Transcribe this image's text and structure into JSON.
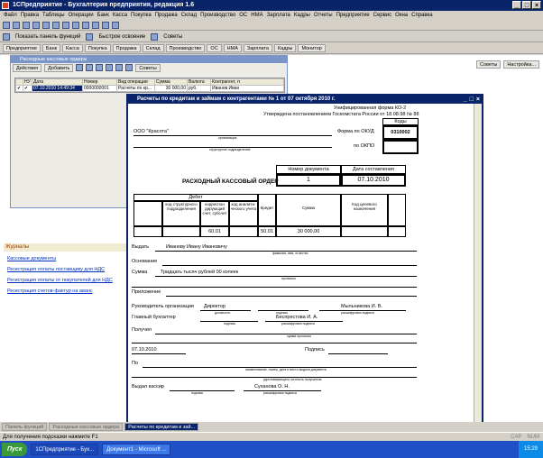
{
  "app": {
    "title": "1СПредприятие - Бухгалтерия предприятия, редакция 1.6"
  },
  "menu": [
    "Файл",
    "Правка",
    "Таблицы",
    "Операции",
    "Банк",
    "Касса",
    "Покупка",
    "Продажа",
    "Склад",
    "Производство",
    "ОС",
    "НМА",
    "Зарплата",
    "Кадры",
    "Отчеты",
    "Предприятие",
    "Сервис",
    "Окна",
    "Справка"
  ],
  "toolbar2": {
    "show_panel": "Показать панель функций",
    "quick_start": "Быстрое освоение",
    "tips": "Советы"
  },
  "toolbar3": [
    "Предприятие",
    "Банк",
    "Касса",
    "Покупка",
    "Продажа",
    "Склад",
    "Производство",
    "ОС",
    "НМА",
    "Зарплата",
    "Кадры",
    "Монитор"
  ],
  "workspace": {
    "tips_btn": "Советы",
    "settings_btn": "Настройка..."
  },
  "journal": {
    "title": "Журналы",
    "links": [
      "Кассовые документы",
      "Регистрация оплаты поставщику для НДС",
      "Регистрация оплаты от покупателей для НДС",
      "Регистрация счетов-фактур на аванс"
    ]
  },
  "subwin": {
    "title": "Расходные кассовые ордера",
    "actions": "Действия",
    "add": "Добавить",
    "tips": "Советы",
    "columns": [
      "",
      "НУ",
      "Дата",
      "Номер",
      "Вид операции",
      "Сумма",
      "Валюта",
      "Контрагент, п"
    ],
    "rows": [
      [
        "✔",
        "✔",
        "07.10.2010 14:49:34",
        "0000000001",
        "Расчеты по кр...",
        "30 000,00",
        "руб.",
        "Иванов Иван"
      ]
    ]
  },
  "doc": {
    "title": "Расчеты по кредитам и займам с контрагентами № 1 от 07 октября 2010 г.",
    "form_header": "Унифицированная форма КО-2",
    "approved": "Утверждена постановлением Госкомстата России от 18.08.98 № 88",
    "codes": "Коды",
    "okud_label": "Форма по ОКУД",
    "okud_value": "0310002",
    "okpo_label": "по ОКПО",
    "org": "ООО \"Красота\"",
    "org_caption": "организация",
    "subdiv_caption": "структурное подразделение",
    "docnum_label": "Номер документа",
    "date_label": "Дата составления",
    "docnum": "1",
    "date": "07.10.2010",
    "doc_name": "РАСХОДНЫЙ КАССОВЫЙ ОРДЕР",
    "debit": "Дебет",
    "col_struct": "код структурного подразделения",
    "col_corr": "корреспон дирующий счет, субсчет",
    "col_analytic": "код аналити- ческого учета",
    "col_credit": "Кредит",
    "col_sum": "Сумма",
    "col_target": "Код целевого назначения",
    "val_corr": "60.01",
    "val_credit": "50.01",
    "val_sum": "30 000,00",
    "issue_label": "Выдать",
    "issue_value": "Иванову Ивану Ивановичу",
    "issue_caption": "фамилия, имя, отчество",
    "basis_label": "Основание",
    "sum_label": "Сумма",
    "sum_value": "Тридцать тысяч рублей 00 копеек",
    "sum_caption": "прописью",
    "appendix_label": "Приложение",
    "head_label": "Руководитель организации",
    "head_pos": "Директор",
    "head_name": "Мыльникова И. В.",
    "pos_caption": "должность",
    "sign_caption": "подпись",
    "decode_caption": "расшифровка подписи",
    "accountant_label": "Главный бухгалтер",
    "accountant_name": "Беспрестова И. А.",
    "received_label": "Получил",
    "amount_caption": "сумма прописью",
    "date2": "07.10.2010",
    "signature_label": "Подпись",
    "by_label": "По",
    "id_caption": "наименование, номер, дата и место выдачи документа",
    "id_caption2": "удостоверяющего личность получателя",
    "cashier_label": "Выдал кассир",
    "cashier_name": "Суханова О. Н."
  },
  "tabs": [
    "Панель функций",
    "Расходные кассовые ордера",
    "Расчеты по кредитам и зай..."
  ],
  "status": {
    "hint": "Для получения подсказки нажмите F1",
    "caps": "CAP",
    "num": "NUM"
  },
  "taskbar": {
    "start": "Пуск",
    "items": [
      "1СПредприятие - Бух...",
      "Документ1 - Microsoft ..."
    ],
    "clock": "15:29"
  }
}
